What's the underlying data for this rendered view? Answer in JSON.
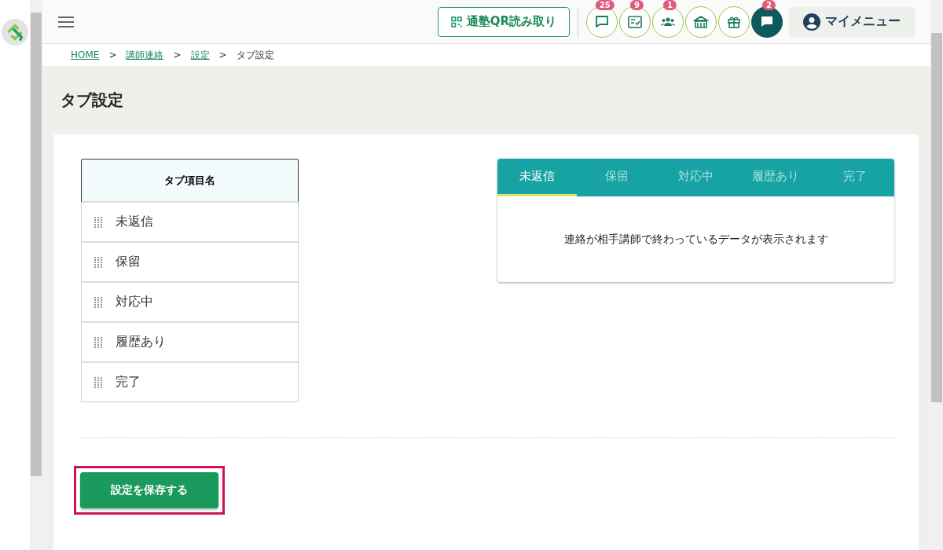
{
  "header": {
    "qr_button": "通塾QR読み取り",
    "icon_buttons": [
      {
        "kind": "chat",
        "badge": "25",
        "filled": false
      },
      {
        "kind": "checklist",
        "badge": "9",
        "filled": false
      },
      {
        "kind": "group",
        "badge": "1",
        "filled": false
      },
      {
        "kind": "school",
        "filled": false
      },
      {
        "kind": "gift",
        "filled": false
      },
      {
        "kind": "message",
        "badge": "2",
        "filled": true
      }
    ],
    "my_menu": "マイメニュー"
  },
  "breadcrumb": [
    {
      "label": "HOME",
      "link": true
    },
    {
      "label": "講師連絡",
      "link": true
    },
    {
      "label": "設定",
      "link": true
    },
    {
      "label": "タブ設定",
      "link": false
    }
  ],
  "breadcrumb_separator": ">",
  "page_title": "タブ設定",
  "tab_list": {
    "header": "タブ項目名",
    "items": [
      "未返信",
      "保留",
      "対応中",
      "履歴あり",
      "完了"
    ]
  },
  "preview": {
    "tabs": [
      {
        "label": "未返信",
        "selected": true
      },
      {
        "label": "保留",
        "selected": false
      },
      {
        "label": "対応中",
        "selected": false
      },
      {
        "label": "履歴あり",
        "selected": false
      },
      {
        "label": "完了",
        "selected": false
      }
    ],
    "message": "連絡が相手講師で終わっているデータが表示されます"
  },
  "save_button": {
    "label": "設定を保存する",
    "highlighted": true
  }
}
